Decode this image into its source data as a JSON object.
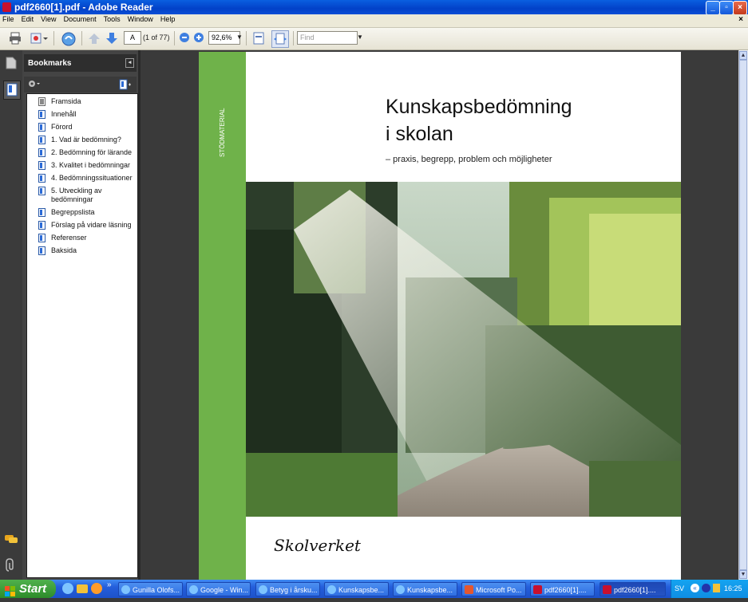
{
  "window": {
    "title": "pdf2660[1].pdf - Adobe Reader",
    "min": "_",
    "max": "▫",
    "close": "×"
  },
  "menu": {
    "items": [
      "File",
      "Edit",
      "View",
      "Document",
      "Tools",
      "Window",
      "Help"
    ],
    "close": "×"
  },
  "toolbar": {
    "page_value": "A",
    "page_count": "(1 of 77)",
    "zoom": "92,6%",
    "find_placeholder": "Find"
  },
  "bookmarks": {
    "title": "Bookmarks",
    "items": [
      "Framsida",
      "Innehåll",
      "Förord",
      "1. Vad är bedömning?",
      "2. Bedömning för lärande",
      "3. Kvalitet i bedömningar",
      "4. Bedömningssituationer",
      "5. Utveckling av",
      "bedömningar",
      "Begreppslista",
      "Förslag på vidare läsning",
      "Referenser",
      "Baksida"
    ]
  },
  "document": {
    "side_label": "STÖDMATERIAL",
    "title_line1": "Kunskapsbedömning",
    "title_line2": "i skolan",
    "subtitle": "– praxis, begrepp, problem och möjligheter",
    "logo": "Skolverket"
  },
  "taskbar": {
    "start": "Start",
    "more": "»",
    "tasks": [
      "Gunilla Olofs...",
      "Google - Win...",
      "Betyg i årsku...",
      "Kunskapsbe...",
      "Kunskapsbe...",
      "Microsoft Po...",
      "pdf2660[1]....",
      "pdf2660[1]...."
    ],
    "lang": "SV",
    "clock": "16:25"
  },
  "colors": {
    "accent_green": "#6fb24a",
    "taskbar_blue": "#245edb"
  }
}
